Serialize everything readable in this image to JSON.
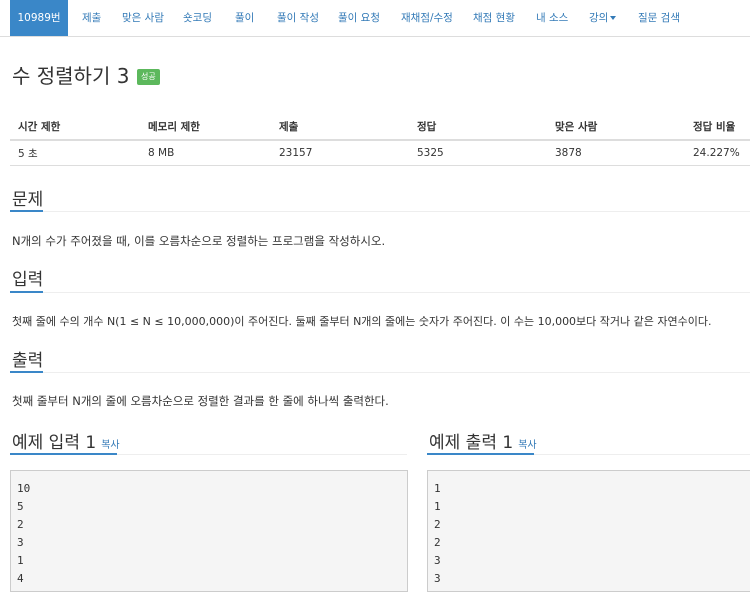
{
  "nav": {
    "items": [
      "10989번",
      "제출",
      "맞은 사람",
      "숏코딩",
      "풀이",
      "풀이 작성",
      "풀이 요청",
      "재채점/수정",
      "채점 현황",
      "내 소스",
      "강의",
      "질문 검색"
    ]
  },
  "problem": {
    "title": "수 정렬하기 3",
    "badge": "성공"
  },
  "stats": {
    "headers": [
      "시간 제한",
      "메모리 제한",
      "제출",
      "정답",
      "맞은 사람",
      "정답 비율"
    ],
    "values": [
      "5 초",
      "8 MB",
      "23157",
      "5325",
      "3878",
      "24.227%"
    ]
  },
  "sections": {
    "problem_heading": "문제",
    "problem_text": "N개의 수가 주어졌을 때, 이를 오름차순으로 정렬하는 프로그램을 작성하시오.",
    "input_heading": "입력",
    "input_text": "첫째 줄에 수의 개수 N(1 ≤ N ≤ 10,000,000)이 주어진다. 둘째 줄부터 N개의 줄에는 숫자가 주어진다. 이 수는 10,000보다 작거나 같은 자연수이다.",
    "output_heading": "출력",
    "output_text": "첫째 줄부터 N개의 줄에 오름차순으로 정렬한 결과를 한 줄에 하나씩 출력한다."
  },
  "examples": {
    "input_title": "예제 입력 1",
    "output_title": "예제 출력 1",
    "copy_label": "복사",
    "input_lines": [
      "10",
      "5",
      "2",
      "3",
      "1",
      "4"
    ],
    "output_lines": [
      "1",
      "1",
      "2",
      "2",
      "3",
      "3"
    ]
  },
  "colors": {
    "accent": "#3a87c8",
    "link": "#337ab7",
    "success": "#5cb85c"
  }
}
